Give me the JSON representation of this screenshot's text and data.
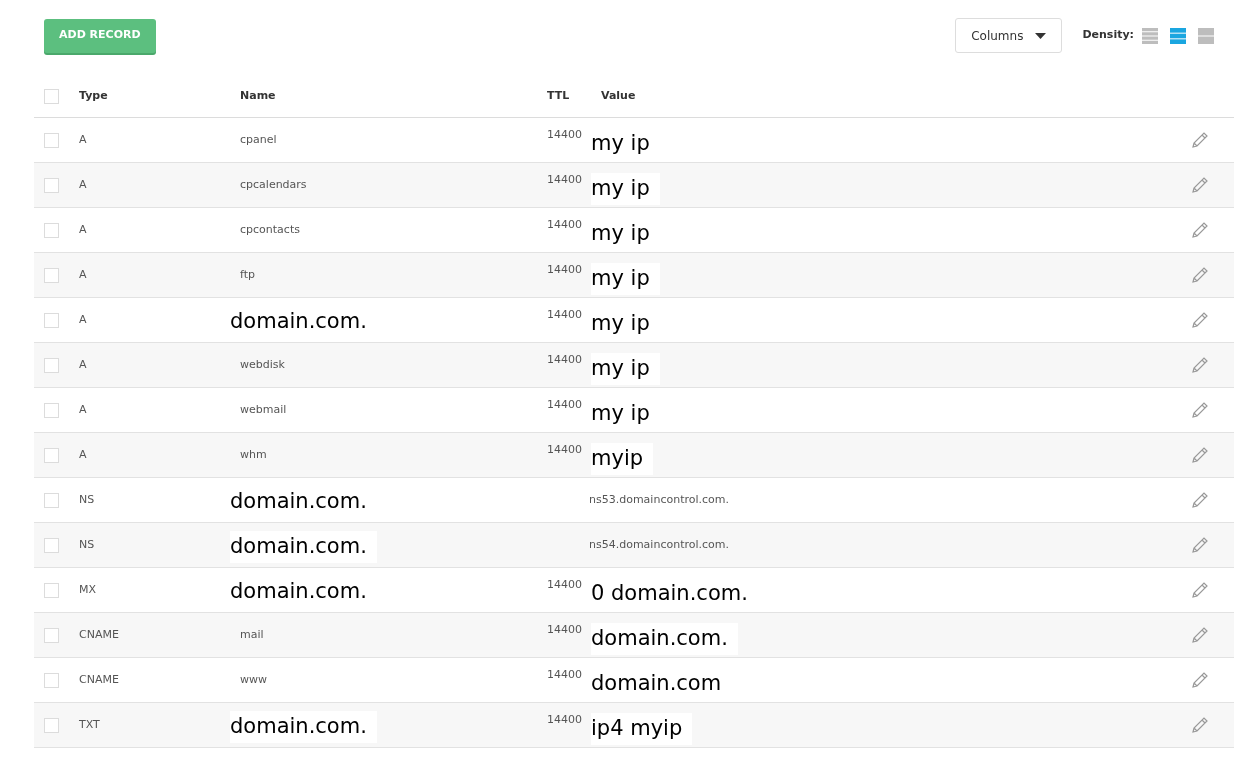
{
  "toolbar": {
    "add_button": "ADD RECORD",
    "columns_button": "Columns",
    "density_label": "Density:",
    "density_options": [
      {
        "kind": "compact",
        "selected": false
      },
      {
        "kind": "standard",
        "selected": true
      },
      {
        "kind": "comfortable",
        "selected": false
      }
    ]
  },
  "table": {
    "select_all_checked": false,
    "columns": [
      "Type",
      "Name",
      "TTL",
      "Value"
    ],
    "rows": [
      {
        "checked": false,
        "type": "A",
        "name": "cpanel",
        "name_large": false,
        "ttl": "14400",
        "value": "my ip",
        "value_large": true
      },
      {
        "checked": false,
        "type": "A",
        "name": "cpcalendars",
        "name_large": false,
        "ttl": "14400",
        "value": "my ip",
        "value_large": true
      },
      {
        "checked": false,
        "type": "A",
        "name": "cpcontacts",
        "name_large": false,
        "ttl": "14400",
        "value": "my ip",
        "value_large": true
      },
      {
        "checked": false,
        "type": "A",
        "name": "ftp",
        "name_large": false,
        "ttl": "14400",
        "value": "my ip",
        "value_large": true
      },
      {
        "checked": false,
        "type": "A",
        "name": "domain.com.",
        "name_large": true,
        "ttl": "14400",
        "value": "my ip",
        "value_large": true
      },
      {
        "checked": false,
        "type": "A",
        "name": "webdisk",
        "name_large": false,
        "ttl": "14400",
        "value": "my ip",
        "value_large": true
      },
      {
        "checked": false,
        "type": "A",
        "name": "webmail",
        "name_large": false,
        "ttl": "14400",
        "value": "my ip",
        "value_large": true
      },
      {
        "checked": false,
        "type": "A",
        "name": "whm",
        "name_large": false,
        "ttl": "14400",
        "value": "myip",
        "value_large": true
      },
      {
        "checked": false,
        "type": "NS",
        "name": "domain.com.",
        "name_large": true,
        "value": "ns53.domaincontrol.com.",
        "value_large": false
      },
      {
        "checked": false,
        "type": "NS",
        "name": "domain.com.",
        "name_large": true,
        "value": "ns54.domaincontrol.com.",
        "value_large": false
      },
      {
        "checked": false,
        "type": "MX",
        "name": "domain.com.",
        "name_large": true,
        "ttl": "14400",
        "value": "0 domain.com.",
        "value_large": true
      },
      {
        "checked": false,
        "type": "CNAME",
        "name": "mail",
        "name_large": false,
        "ttl": "14400",
        "value": "domain.com.",
        "value_large": true
      },
      {
        "checked": false,
        "type": "CNAME",
        "name": "www",
        "name_large": false,
        "ttl": "14400",
        "value": "domain.com",
        "value_large": true
      },
      {
        "checked": false,
        "type": "TXT",
        "name": "domain.com.",
        "name_large": true,
        "ttl": "14400",
        "value": "ip4 myip",
        "value_large": true
      }
    ]
  }
}
